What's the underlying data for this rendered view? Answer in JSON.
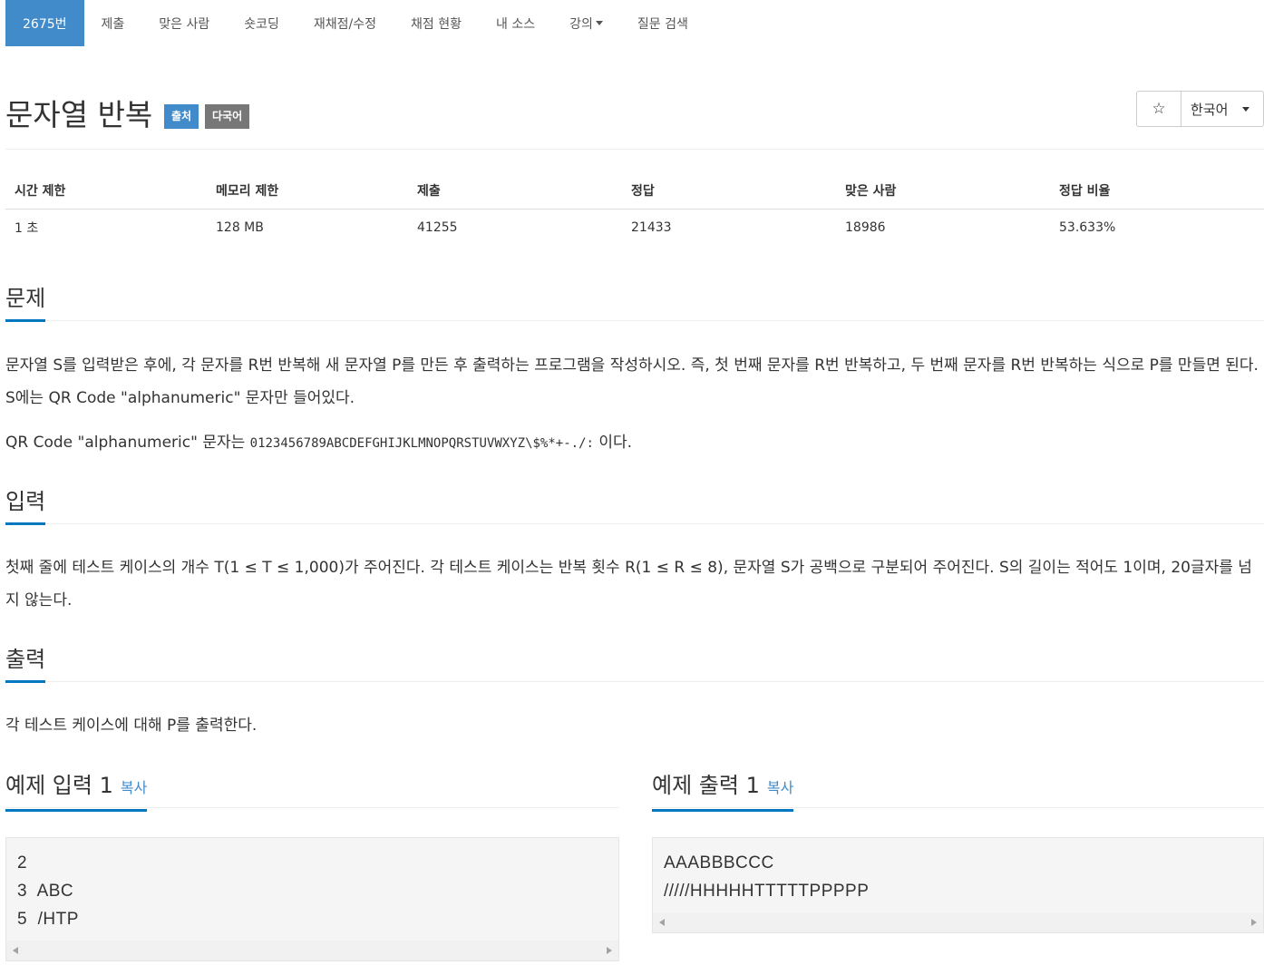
{
  "nav": {
    "tabs": [
      {
        "label": "2675번"
      },
      {
        "label": "제출"
      },
      {
        "label": "맞은 사람"
      },
      {
        "label": "숏코딩"
      },
      {
        "label": "재채점/수정"
      },
      {
        "label": "채점 현황"
      },
      {
        "label": "내 소스"
      },
      {
        "label": "강의"
      },
      {
        "label": "질문 검색"
      }
    ],
    "active_index": 0
  },
  "problem": {
    "title": "문자열 반복",
    "labels": {
      "source": "출처",
      "multilang": "다국어"
    },
    "star_icon": "☆",
    "language": "한국어"
  },
  "info": {
    "headers": [
      "시간 제한",
      "메모리 제한",
      "제출",
      "정답",
      "맞은 사람",
      "정답 비율"
    ],
    "values": [
      "1 초",
      "128 MB",
      "41255",
      "21433",
      "18986",
      "53.633%"
    ]
  },
  "sections": {
    "description": {
      "heading": "문제",
      "p1": "문자열 S를 입력받은 후에, 각 문자를 R번 반복해 새 문자열 P를 만든 후 출력하는 프로그램을 작성하시오. 즉, 첫 번째 문자를 R번 반복하고, 두 번째 문자를 R번 반복하는 식으로 P를 만들면 된다. S에는 QR Code \"alphanumeric\" 문자만 들어있다.",
      "p2_prefix": "QR Code \"alphanumeric\" 문자는 ",
      "p2_code": "0123456789ABCDEFGHIJKLMNOPQRSTUVWXYZ\\$%*+-./:",
      "p2_suffix": " 이다."
    },
    "input": {
      "heading": "입력",
      "text": "첫째 줄에 테스트 케이스의 개수 T(1 ≤ T ≤ 1,000)가 주어진다. 각 테스트 케이스는 반복 횟수 R(1 ≤ R ≤ 8), 문자열 S가 공백으로 구분되어 주어진다. S의 길이는 적어도 1이며, 20글자를 넘지 않는다."
    },
    "output": {
      "heading": "출력",
      "text": "각 테스트 케이스에 대해 P를 출력한다."
    }
  },
  "samples": {
    "input": {
      "heading": "예제 입력 1",
      "copy": "복사",
      "text": "2\n3  ABC\n5  /HTP"
    },
    "output": {
      "heading": "예제 출력 1",
      "copy": "복사",
      "text": "AAABBBCCC\n/////HHHHHTTTTTPPPPP"
    }
  },
  "colors": {
    "accent": "#428bca",
    "headline_underline": "#0078c0",
    "label_gray": "#777777"
  }
}
